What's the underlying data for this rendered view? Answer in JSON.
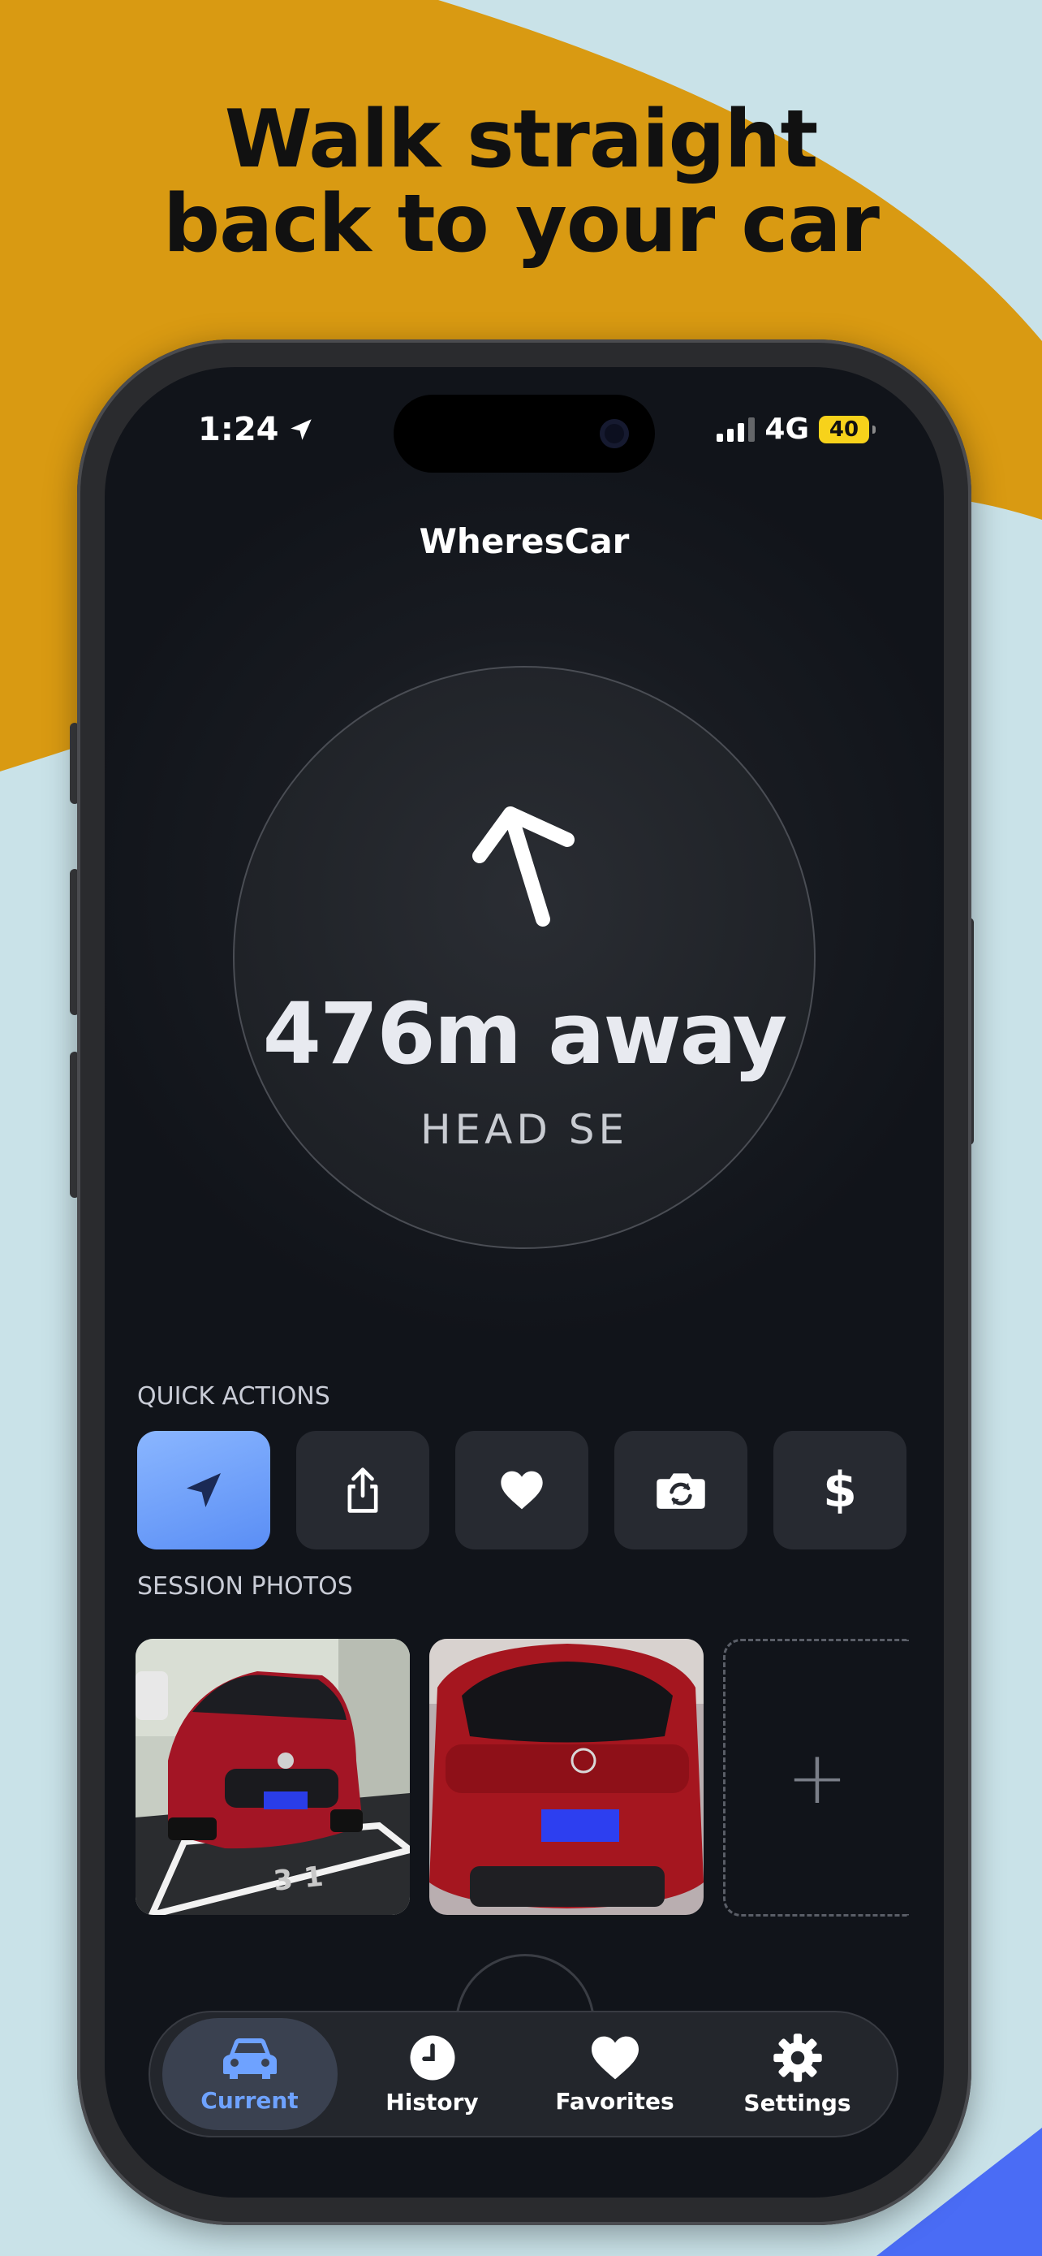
{
  "headline": {
    "line1": "Walk straight",
    "line2": "back to your car"
  },
  "status_bar": {
    "time": "1:24",
    "network": "4G",
    "battery": "40"
  },
  "app": {
    "title": "WheresCar"
  },
  "navigation": {
    "distance": "476m away",
    "heading": "HEAD SE"
  },
  "quick_actions": {
    "label": "QUICK ACTIONS",
    "items": [
      {
        "name": "navigate",
        "icon": "location-arrow-icon",
        "active": true
      },
      {
        "name": "share",
        "icon": "share-icon",
        "active": false
      },
      {
        "name": "favorite",
        "icon": "heart-icon",
        "active": false
      },
      {
        "name": "switch-camera",
        "icon": "camera-rotate-icon",
        "active": false
      },
      {
        "name": "cost",
        "icon": "dollar-icon",
        "glyph": "$",
        "active": false
      }
    ]
  },
  "session_photos": {
    "label": "SESSION PHOTOS",
    "photos": [
      {
        "name": "car-front-photo",
        "spot_number": "31"
      },
      {
        "name": "car-rear-photo"
      }
    ],
    "add_glyph": "+"
  },
  "tabbar": {
    "tabs": [
      {
        "label": "Current",
        "icon": "car-icon",
        "active": true
      },
      {
        "label": "History",
        "icon": "clock-icon",
        "active": false
      },
      {
        "label": "Favorites",
        "icon": "heart-icon",
        "active": false
      },
      {
        "label": "Settings",
        "icon": "gear-icon",
        "active": false
      }
    ]
  },
  "colors": {
    "accent": "#6ea2ff",
    "headline_bg": "#d99a12",
    "page_bg": "#c9e2e8",
    "corner_accent": "#4a6cf5",
    "battery": "#f7d21b"
  }
}
